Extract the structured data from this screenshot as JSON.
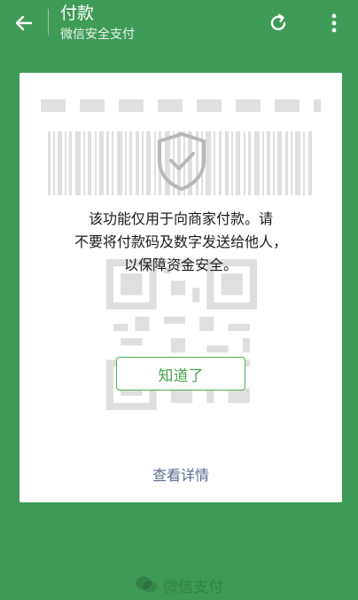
{
  "header": {
    "title": "付款",
    "subtitle": "微信安全支付"
  },
  "dialog": {
    "message_line1": "该功能仅用于向商家付款。请",
    "message_line2": "不要将付款码及数字发送给他人，",
    "message_line3": "以保障资金安全。",
    "confirm_label": "知道了",
    "details_label": "查看详情"
  },
  "footer": {
    "brand": "微信支付"
  },
  "colors": {
    "background": "#3d9a57",
    "accent": "#46a548",
    "link": "#5b6b8c"
  },
  "icons": {
    "back": "arrow-left-icon",
    "refresh": "refresh-icon",
    "more": "more-vertical-icon",
    "shield": "shield-check-icon",
    "brand": "wechat-logo-icon"
  }
}
